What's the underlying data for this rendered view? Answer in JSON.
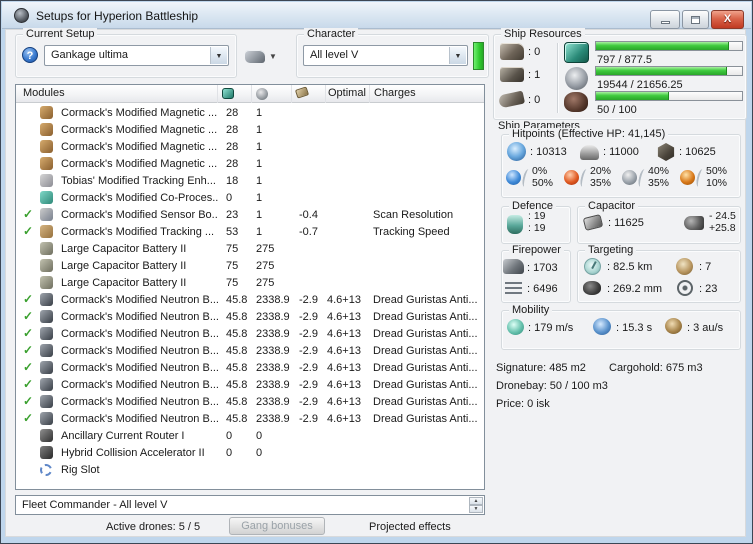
{
  "window": {
    "title": "Setups for Hyperion Battleship"
  },
  "setup": {
    "group_label": "Current Setup",
    "value": "Gankage ultima"
  },
  "character": {
    "group_label": "Character",
    "value": "All level V"
  },
  "table": {
    "headers": {
      "modules": "Modules",
      "optimal": "Optimal",
      "charges": "Charges"
    },
    "rows": [
      {
        "active": false,
        "icon": "magstab",
        "name": "Cormack's Modified Magnetic ...",
        "cpu": "28",
        "pg": "1",
        "cap": "",
        "optimal": "",
        "charges": ""
      },
      {
        "active": false,
        "icon": "magstab",
        "name": "Cormack's Modified Magnetic ...",
        "cpu": "28",
        "pg": "1",
        "cap": "",
        "optimal": "",
        "charges": ""
      },
      {
        "active": false,
        "icon": "magstab",
        "name": "Cormack's Modified Magnetic ...",
        "cpu": "28",
        "pg": "1",
        "cap": "",
        "optimal": "",
        "charges": ""
      },
      {
        "active": false,
        "icon": "magstab",
        "name": "Cormack's Modified Magnetic ...",
        "cpu": "28",
        "pg": "1",
        "cap": "",
        "optimal": "",
        "charges": ""
      },
      {
        "active": false,
        "icon": "tracking-enhancer",
        "name": "Tobias' Modified Tracking Enh...",
        "cpu": "18",
        "pg": "1",
        "cap": "",
        "optimal": "",
        "charges": ""
      },
      {
        "active": false,
        "icon": "co-processor",
        "name": "Cormack's Modified Co-Proces...",
        "cpu": "0",
        "pg": "1",
        "cap": "",
        "optimal": "",
        "charges": ""
      },
      {
        "active": true,
        "icon": "sensor-booster",
        "name": "Cormack's Modified Sensor Bo...",
        "cpu": "23",
        "pg": "1",
        "cap": "-0.4",
        "optimal": "",
        "charges": "Scan Resolution"
      },
      {
        "active": true,
        "icon": "tracking-computer",
        "name": "Cormack's Modified Tracking ...",
        "cpu": "53",
        "pg": "1",
        "cap": "-0.7",
        "optimal": "",
        "charges": "Tracking Speed"
      },
      {
        "active": false,
        "icon": "cap-battery",
        "name": "Large Capacitor Battery II",
        "cpu": "75",
        "pg": "275",
        "cap": "",
        "optimal": "",
        "charges": ""
      },
      {
        "active": false,
        "icon": "cap-battery",
        "name": "Large Capacitor Battery II",
        "cpu": "75",
        "pg": "275",
        "cap": "",
        "optimal": "",
        "charges": ""
      },
      {
        "active": false,
        "icon": "cap-battery",
        "name": "Large Capacitor Battery II",
        "cpu": "75",
        "pg": "275",
        "cap": "",
        "optimal": "",
        "charges": ""
      },
      {
        "active": true,
        "icon": "blaster",
        "name": "Cormack's Modified Neutron B...",
        "cpu": "45.8",
        "pg": "2338.9",
        "cap": "-2.9",
        "optimal": "4.6+13",
        "charges": "Dread Guristas Anti..."
      },
      {
        "active": true,
        "icon": "blaster",
        "name": "Cormack's Modified Neutron B...",
        "cpu": "45.8",
        "pg": "2338.9",
        "cap": "-2.9",
        "optimal": "4.6+13",
        "charges": "Dread Guristas Anti..."
      },
      {
        "active": true,
        "icon": "blaster",
        "name": "Cormack's Modified Neutron B...",
        "cpu": "45.8",
        "pg": "2338.9",
        "cap": "-2.9",
        "optimal": "4.6+13",
        "charges": "Dread Guristas Anti..."
      },
      {
        "active": true,
        "icon": "blaster",
        "name": "Cormack's Modified Neutron B...",
        "cpu": "45.8",
        "pg": "2338.9",
        "cap": "-2.9",
        "optimal": "4.6+13",
        "charges": "Dread Guristas Anti..."
      },
      {
        "active": true,
        "icon": "blaster",
        "name": "Cormack's Modified Neutron B...",
        "cpu": "45.8",
        "pg": "2338.9",
        "cap": "-2.9",
        "optimal": "4.6+13",
        "charges": "Dread Guristas Anti..."
      },
      {
        "active": true,
        "icon": "blaster",
        "name": "Cormack's Modified Neutron B...",
        "cpu": "45.8",
        "pg": "2338.9",
        "cap": "-2.9",
        "optimal": "4.6+13",
        "charges": "Dread Guristas Anti..."
      },
      {
        "active": true,
        "icon": "blaster",
        "name": "Cormack's Modified Neutron B...",
        "cpu": "45.8",
        "pg": "2338.9",
        "cap": "-2.9",
        "optimal": "4.6+13",
        "charges": "Dread Guristas Anti..."
      },
      {
        "active": true,
        "icon": "blaster",
        "name": "Cormack's Modified Neutron B...",
        "cpu": "45.8",
        "pg": "2338.9",
        "cap": "-2.9",
        "optimal": "4.6+13",
        "charges": "Dread Guristas Anti..."
      },
      {
        "active": false,
        "icon": "rig-acr",
        "name": "Ancillary Current Router I",
        "cpu": "0",
        "pg": "0",
        "cap": "",
        "optimal": "",
        "charges": ""
      },
      {
        "active": false,
        "icon": "rig-hca",
        "name": "Hybrid Collision Accelerator II",
        "cpu": "0",
        "pg": "0",
        "cap": "",
        "optimal": "",
        "charges": ""
      },
      {
        "active": false,
        "icon": "rig-empty",
        "name": "Rig Slot",
        "cpu": "",
        "pg": "",
        "cap": "",
        "optimal": "",
        "charges": ""
      }
    ]
  },
  "fleet": {
    "value": "Fleet Commander - All level V"
  },
  "statusbar": {
    "active_drones": "Active drones: 5 / 5",
    "gang_bonuses": "Gang bonuses",
    "projected_effects": "Projected effects"
  },
  "resources": {
    "group_label": "Ship Resources",
    "turret_hardpoints": ": 0",
    "launcher_hardpoints": ": 1",
    "rig_slots": ": 0",
    "cpu": {
      "text": "797 / 877.5",
      "pct": 91
    },
    "powergrid": {
      "text": "19544 / 21656.25",
      "pct": 90
    },
    "drones": {
      "text": "50 / 100",
      "pct": 50
    }
  },
  "parameters": {
    "group_label": "Ship Parameters",
    "hitpoints": {
      "group_label": "Hitpoints (Effective HP: 41,145)",
      "shield": ": 10313",
      "armor": ": 11000",
      "structure": ": 10625",
      "resists": [
        {
          "name": "em",
          "shield": "0%",
          "armor": "50%"
        },
        {
          "name": "thermal",
          "shield": "20%",
          "armor": "35%"
        },
        {
          "name": "kinetic",
          "shield": "40%",
          "armor": "35%"
        },
        {
          "name": "explosive",
          "shield": "50%",
          "armor": "10%"
        }
      ]
    },
    "defence": {
      "group_label": "Defence",
      "value1": ": 19",
      "value2": ": 19"
    },
    "capacitor": {
      "group_label": "Capacitor",
      "amount": ": 11625",
      "drain": "- 24.5",
      "recharge": "+25.8"
    },
    "firepower": {
      "group_label": "Firepower",
      "dps": ": 1703",
      "volley": ": 6496"
    },
    "targeting": {
      "group_label": "Targeting",
      "range": ": 82.5 km",
      "max_targets": ": 7",
      "scan_resolution": ": 269.2 mm",
      "sensor_strength": ": 23"
    },
    "mobility": {
      "group_label": "Mobility",
      "speed": ": 179 m/s",
      "align_time": ": 15.3 s",
      "warp_speed": ": 3 au/s"
    },
    "summary": {
      "signature": "Signature: 485 m2",
      "cargohold": "Cargohold: 675 m3",
      "dronebay": "Dronebay: 50 / 100 m3",
      "price": "Price: 0 isk"
    }
  }
}
